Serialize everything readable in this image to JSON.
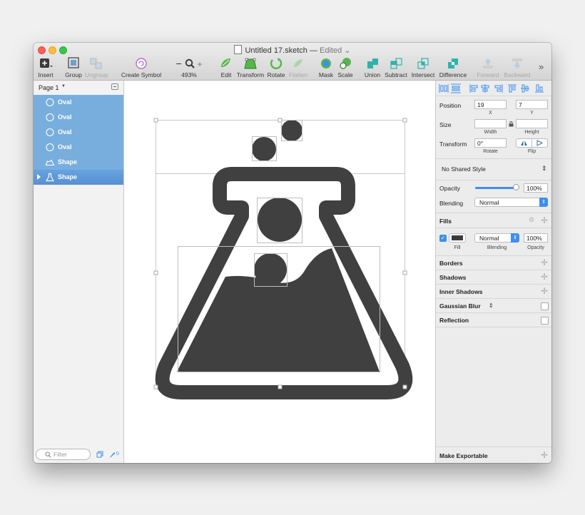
{
  "window": {
    "title": "Untitled 17.sketch",
    "title_separator": "—",
    "status": "Edited",
    "status_arrow": "⌄"
  },
  "toolbar": {
    "insert": "Insert",
    "group": "Group",
    "ungroup": "Ungroup",
    "create_symbol": "Create Symbol",
    "zoom_minus": "−",
    "zoom_plus": "+",
    "zoom_level": "493%",
    "edit": "Edit",
    "transform": "Transform",
    "rotate": "Rotate",
    "flatten": "Flatten",
    "mask": "Mask",
    "scale": "Scale",
    "union": "Union",
    "subtract": "Subtract",
    "intersect": "Intersect",
    "difference": "Difference",
    "forward": "Forward",
    "backward": "Backward",
    "overflow": "»"
  },
  "sidebar": {
    "page_label": "Page 1",
    "layers": [
      {
        "name": "Oval",
        "icon": "oval-icon"
      },
      {
        "name": "Oval",
        "icon": "oval-icon"
      },
      {
        "name": "Oval",
        "icon": "oval-icon"
      },
      {
        "name": "Oval",
        "icon": "oval-icon"
      },
      {
        "name": "Shape",
        "icon": "shape-icon"
      },
      {
        "name": "Shape",
        "icon": "flask-icon"
      }
    ],
    "filter_placeholder": "Filter",
    "slice_count": "0"
  },
  "inspector": {
    "position_label": "Position",
    "position_x": "19",
    "position_y": "7",
    "x_label": "X",
    "y_label": "Y",
    "size_label": "Size",
    "width_value": "",
    "height_value": "",
    "width_label": "Width",
    "height_label": "Height",
    "transform_label": "Transform",
    "rotate_value": "0°",
    "rotate_label": "Rotate",
    "flip_label": "Flip",
    "shared_style": "No Shared Style",
    "opacity_label": "Opacity",
    "opacity_value": "100%",
    "opacity_fraction": 1.0,
    "blending_label": "Blending",
    "blending_value": "Normal",
    "fills_label": "Fills",
    "fill_label": "Fill",
    "fill_color": "#3c3c3c",
    "fill_blending": "Normal",
    "fill_opacity": "100%",
    "fill_blending_label": "Blending",
    "fill_opacity_label": "Opacity",
    "borders_label": "Borders",
    "shadows_label": "Shadows",
    "inner_shadows_label": "Inner Shadows",
    "gaussian_blur_label": "Gaussian Blur",
    "reflection_label": "Reflection",
    "make_exportable_label": "Make Exportable"
  },
  "colors": {
    "accent": "#3d8ef0",
    "selection": "#5b95d7",
    "flask": "#404040"
  }
}
